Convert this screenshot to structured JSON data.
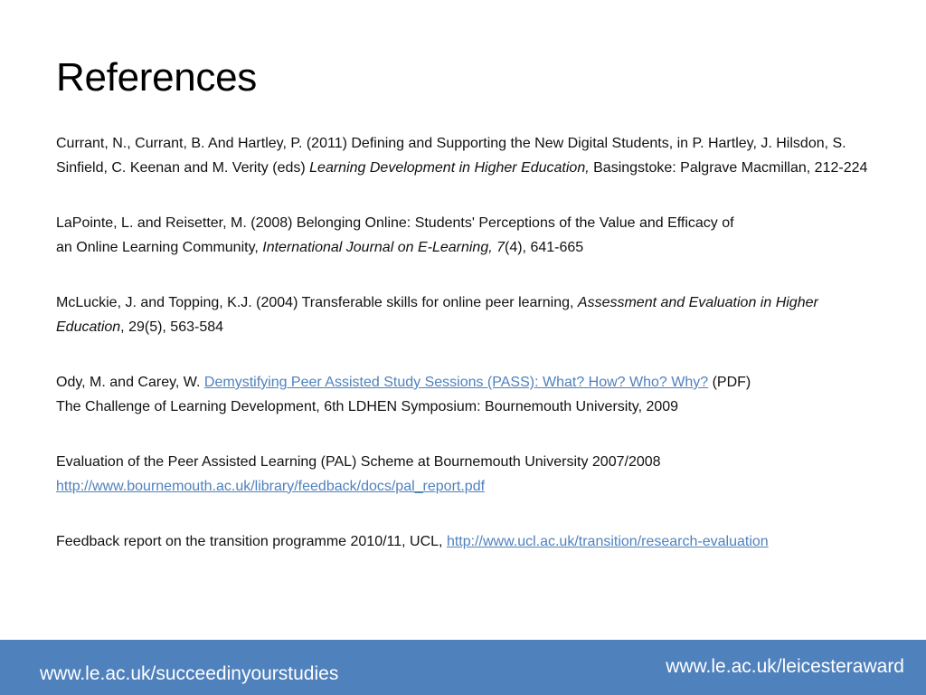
{
  "slide": {
    "title": "References"
  },
  "references": {
    "r1": {
      "pre": "Currant, N., Currant, B. And Hartley, P. (2011) Defining and Supporting the New Digital Students, in P. Hartley, J. Hilsdon, S. Sinfield, C. Keenan and M. Verity (eds) ",
      "italic": "Learning Development in Higher Education,",
      "post": " Basingstoke: Palgrave Macmillan, 212-224"
    },
    "r2": {
      "pre_line1": "LaPointe, L. and Reisetter, M. (2008) Belonging Online: Students' Perceptions of the Value and Efficacy of",
      "pre_line2": "an Online Learning Community, ",
      "italic": "International Journal on E-Learning, 7",
      "post": "(4), 641-665"
    },
    "r3": {
      "pre": "McLuckie, J. and Topping, K.J. (2004) Transferable skills for online peer learning, ",
      "italic": "Assessment and Evaluation in Higher Education",
      "post": ", 29(5), 563-584"
    },
    "r4": {
      "pre": "Ody, M. and Carey, W. ",
      "link": "Demystifying Peer Assisted Study Sessions (PASS): What? How? Who? Why?",
      "post": " (PDF)",
      "line2": "The Challenge of Learning Development, 6th LDHEN Symposium: Bournemouth University, 2009"
    },
    "r5": {
      "text": "Evaluation of the Peer Assisted Learning (PAL) Scheme at Bournemouth University 2007/2008",
      "link": "http://www.bournemouth.ac.uk/library/feedback/docs/pal_report.pdf"
    },
    "r6": {
      "pre": "Feedback report on the transition programme 2010/11, UCL, ",
      "link": "http://www.ucl.ac.uk/transition/research-evaluation"
    }
  },
  "footer": {
    "left_link": "www.le.ac.uk/succeedinyourstudies",
    "right_link": "www.le.ac.uk/leicesteraward"
  },
  "colors": {
    "footer_bar": "#4f81bd",
    "hyperlink": "#4f81bd"
  }
}
